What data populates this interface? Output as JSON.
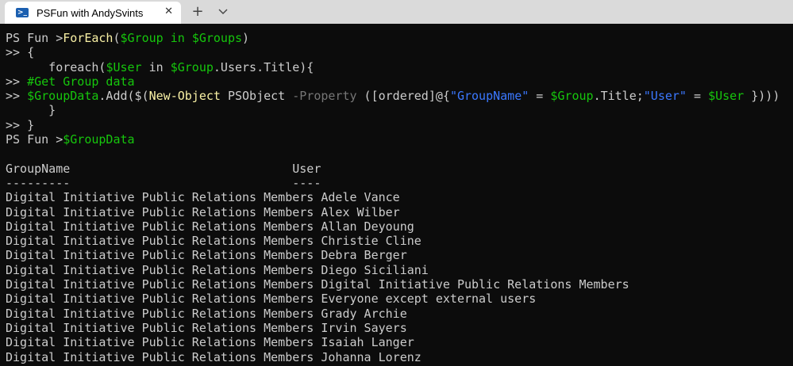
{
  "tab": {
    "title": "PSFun with AndySvints",
    "icon": "powershell-icon",
    "close_glyph": "✕"
  },
  "new_tab_glyph": "+",
  "dropdown_icon": "chevron-down-icon",
  "colors": {
    "background": "#0c0c0c",
    "text": "#cccccc",
    "cmdlet": "#f9f1a5",
    "variable": "#16c60c",
    "parameter": "#767676",
    "string": "#3b78ff"
  },
  "lines": [
    [
      {
        "t": "PS Fun >",
        "c": ""
      },
      {
        "t": "ForEach",
        "c": "cmd"
      },
      {
        "t": "(",
        "c": ""
      },
      {
        "t": "$Group",
        "c": "var"
      },
      {
        "t": " ",
        "c": ""
      },
      {
        "t": "in",
        "c": "var"
      },
      {
        "t": " ",
        "c": ""
      },
      {
        "t": "$Groups",
        "c": "var"
      },
      {
        "t": ")",
        "c": ""
      }
    ],
    [
      {
        "t": ">> {",
        "c": ""
      }
    ],
    [
      {
        "t": "      foreach(",
        "c": ""
      },
      {
        "t": "$User",
        "c": "var"
      },
      {
        "t": " in ",
        "c": ""
      },
      {
        "t": "$Group",
        "c": "var"
      },
      {
        "t": ".Users.Title){",
        "c": ""
      }
    ],
    [
      {
        "t": ">> ",
        "c": ""
      },
      {
        "t": "#Get Group data",
        "c": "cmt"
      }
    ],
    [
      {
        "t": ">> ",
        "c": ""
      },
      {
        "t": "$GroupData",
        "c": "var"
      },
      {
        "t": ".Add($(",
        "c": ""
      },
      {
        "t": "New-Object",
        "c": "cmd"
      },
      {
        "t": " PSObject ",
        "c": ""
      },
      {
        "t": "-Property",
        "c": "param"
      },
      {
        "t": " ([ordered]@{",
        "c": ""
      },
      {
        "t": "\"GroupName\"",
        "c": "str"
      },
      {
        "t": " = ",
        "c": ""
      },
      {
        "t": "$Group",
        "c": "var"
      },
      {
        "t": ".Title;",
        "c": ""
      },
      {
        "t": "\"User\"",
        "c": "str"
      },
      {
        "t": " = ",
        "c": ""
      },
      {
        "t": "$User",
        "c": "var"
      },
      {
        "t": " })))",
        "c": ""
      }
    ],
    [
      {
        "t": "      }",
        "c": ""
      }
    ],
    [
      {
        "t": ">> }",
        "c": ""
      }
    ],
    [
      {
        "t": "PS Fun >",
        "c": ""
      },
      {
        "t": "$GroupData",
        "c": "var"
      }
    ],
    [
      {
        "t": "",
        "c": ""
      }
    ],
    [
      {
        "t": "GroupName                               User",
        "c": ""
      }
    ],
    [
      {
        "t": "---------                               ----",
        "c": ""
      }
    ],
    [
      {
        "t": "Digital Initiative Public Relations Members Adele Vance",
        "c": ""
      }
    ],
    [
      {
        "t": "Digital Initiative Public Relations Members Alex Wilber",
        "c": ""
      }
    ],
    [
      {
        "t": "Digital Initiative Public Relations Members Allan Deyoung",
        "c": ""
      }
    ],
    [
      {
        "t": "Digital Initiative Public Relations Members Christie Cline",
        "c": ""
      }
    ],
    [
      {
        "t": "Digital Initiative Public Relations Members Debra Berger",
        "c": ""
      }
    ],
    [
      {
        "t": "Digital Initiative Public Relations Members Diego Siciliani",
        "c": ""
      }
    ],
    [
      {
        "t": "Digital Initiative Public Relations Members Digital Initiative Public Relations Members",
        "c": ""
      }
    ],
    [
      {
        "t": "Digital Initiative Public Relations Members Everyone except external users",
        "c": ""
      }
    ],
    [
      {
        "t": "Digital Initiative Public Relations Members Grady Archie",
        "c": ""
      }
    ],
    [
      {
        "t": "Digital Initiative Public Relations Members Irvin Sayers",
        "c": ""
      }
    ],
    [
      {
        "t": "Digital Initiative Public Relations Members Isaiah Langer",
        "c": ""
      }
    ],
    [
      {
        "t": "Digital Initiative Public Relations Members Johanna Lorenz",
        "c": ""
      }
    ]
  ]
}
